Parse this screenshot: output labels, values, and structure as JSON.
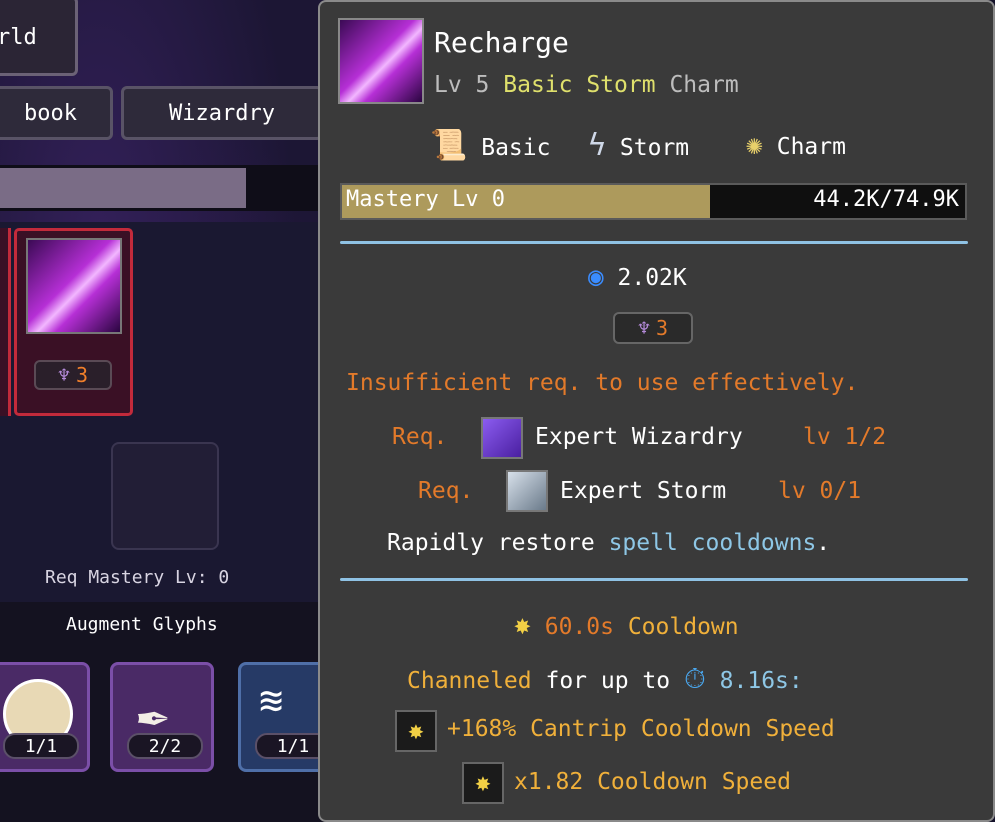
{
  "left": {
    "world_label": "rld",
    "tabs": [
      "book",
      "Wizardry"
    ],
    "spell_badge_count": "3",
    "req_mastery": "Req Mastery Lv: 0",
    "augment_title": "Augment Glyphs",
    "glyph_counts": [
      "1/1",
      "2/2",
      "1/1"
    ]
  },
  "tooltip": {
    "name": "Recharge",
    "level": "Lv 5",
    "category": "Basic Storm",
    "charm": "Charm",
    "tags": [
      "Basic",
      "Storm",
      "Charm"
    ],
    "mastery_label": "Mastery Lv 0",
    "mastery_value": "44.2K/74.9K",
    "mastery_fraction": 0.59,
    "mana_cost": "2.02K",
    "glyph_cost": "3",
    "warning": "Insufficient req. to use effectively.",
    "reqs": [
      {
        "prefix": "Req.",
        "name": "Expert Wizardry",
        "lv": "lv 1/2"
      },
      {
        "prefix": "Req.",
        "name": "Expert Storm",
        "lv": "lv 0/1"
      }
    ],
    "desc_prefix": "Rapidly restore",
    "desc_highlight": "spell cooldowns",
    "desc_suffix": ".",
    "cooldown_value": "60.0s",
    "cooldown_label": "Cooldown",
    "channeled": "Channeled",
    "channel_mid": "for up to",
    "channel_time": "8.16s:",
    "effects": [
      "+168% Cantrip Cooldown Speed",
      "x1.82 Cooldown Speed"
    ]
  }
}
